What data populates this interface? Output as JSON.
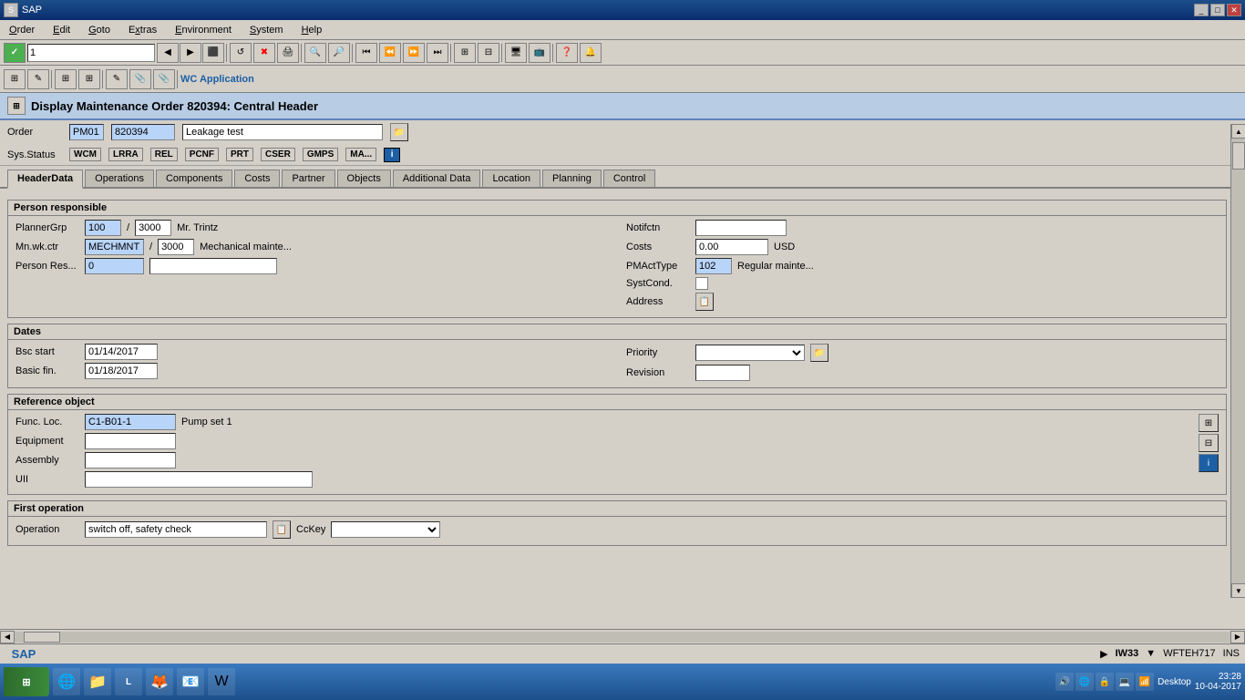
{
  "titlebar": {
    "text": "SAP",
    "buttons": [
      "_",
      "□",
      "✕"
    ]
  },
  "menubar": {
    "items": [
      "Order",
      "Edit",
      "Goto",
      "Extras",
      "Environment",
      "System",
      "Help"
    ]
  },
  "toolbar": {
    "input_value": "1",
    "buttons": [
      "✓",
      "←",
      "→",
      "⬅",
      "📋",
      "🔄",
      "✖",
      "💾",
      "📄",
      "📄",
      "📄",
      "📄",
      "⬡",
      "⬡",
      "⬡",
      "⬡",
      "⬡",
      "⬡",
      "🖥",
      "🖥",
      "❓",
      "🔔"
    ]
  },
  "app_toolbar": {
    "buttons": [
      "⊞",
      "✎",
      "⊞",
      "⊞",
      "✎",
      "📎",
      "📎"
    ],
    "wc_application": "WC Application"
  },
  "page_title": "Display Maintenance Order 820394: Central Header",
  "order_section": {
    "order_label": "Order",
    "order_type": "PM01",
    "order_number": "820394",
    "description": "Leakage test"
  },
  "sys_status": {
    "label": "Sys.Status",
    "badges": [
      "WCM",
      "LRRA",
      "REL",
      "PCNF",
      "PRT",
      "CSER",
      "GMPS",
      "MA..."
    ]
  },
  "tabs": [
    {
      "label": "HeaderData",
      "active": true
    },
    {
      "label": "Operations",
      "active": false
    },
    {
      "label": "Components",
      "active": false
    },
    {
      "label": "Costs",
      "active": false
    },
    {
      "label": "Partner",
      "active": false
    },
    {
      "label": "Objects",
      "active": false
    },
    {
      "label": "Additional Data",
      "active": false
    },
    {
      "label": "Location",
      "active": false
    },
    {
      "label": "Planning",
      "active": false
    },
    {
      "label": "Control",
      "active": false
    }
  ],
  "person_responsible": {
    "section_title": "Person responsible",
    "planner_grp_label": "PlannerGrp",
    "planner_grp_val1": "100",
    "planner_grp_val2": "3000",
    "planner_grp_name": "Mr. Trintz",
    "mn_wk_ctr_label": "Mn.wk.ctr",
    "mn_wk_ctr_val1": "MECHMNT",
    "mn_wk_ctr_val2": "3000",
    "mn_wk_ctr_name": "Mechanical mainte...",
    "person_res_label": "Person Res...",
    "person_res_val": "0",
    "person_res_name": ""
  },
  "right_section": {
    "notifctn_label": "Notifctn",
    "notifctn_val": "",
    "costs_label": "Costs",
    "costs_val": "0.00",
    "costs_currency": "USD",
    "pmact_type_label": "PMActType",
    "pmact_type_val": "102",
    "pmact_type_name": "Regular mainte...",
    "syst_cond_label": "SystCond.",
    "address_label": "Address"
  },
  "dates": {
    "section_title": "Dates",
    "bsc_start_label": "Bsc start",
    "bsc_start_val": "01/14/2017",
    "basic_fin_label": "Basic fin.",
    "basic_fin_val": "01/18/2017",
    "priority_label": "Priority",
    "priority_val": "",
    "revision_label": "Revision",
    "revision_val": ""
  },
  "reference_object": {
    "section_title": "Reference object",
    "func_loc_label": "Func. Loc.",
    "func_loc_val": "C1-B01-1",
    "func_loc_name": "Pump set 1",
    "equipment_label": "Equipment",
    "equipment_val": "",
    "assembly_label": "Assembly",
    "assembly_val": "",
    "uii_label": "UII",
    "uii_val": ""
  },
  "first_operation": {
    "section_title": "First operation",
    "operation_label": "Operation",
    "operation_val": "switch off, safety check",
    "cckey_label": "CcKey",
    "cckey_val": ""
  },
  "sap_status": {
    "logo": "SAP",
    "session": "IW33",
    "user": "WFTEH717",
    "mode": "INS",
    "arrow": "▶",
    "dropdown_arrow": "▼"
  },
  "taskbar": {
    "start_label": "⊞",
    "time": "23:28",
    "date": "10-04-2017",
    "desktop_label": "Desktop"
  }
}
